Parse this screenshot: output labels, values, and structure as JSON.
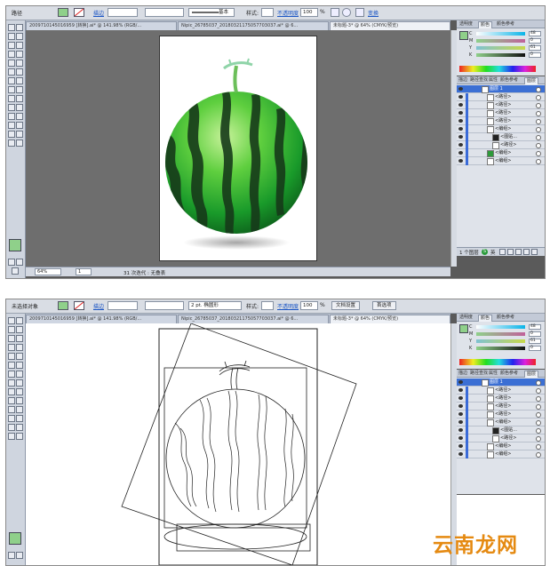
{
  "screenshot1": {
    "control_bar": {
      "selection_label": "路径",
      "stroke_label": "描边",
      "stroke_style": "基本",
      "style_label": "样式:",
      "opacity_label": "不透明度",
      "opacity_value": "100",
      "opacity_unit": "%",
      "transform_link": "变换"
    },
    "tabs": [
      {
        "label": "2009710145016959 [转换].ai* @ 141.98% (RGB/..."
      },
      {
        "label": "Nipic_26785037_20180321175057703037.ai* @ 6..."
      },
      {
        "label": "未标题-3* @ 64% (CMYK/预览)"
      }
    ],
    "status_bar": {
      "zoom": "64%",
      "page": "1",
      "status_text": "31 次迭代 : 无叠表"
    },
    "color_panel": {
      "tabs": [
        "透明度",
        "颜色",
        "颜色参考"
      ],
      "channels": [
        {
          "label": "C",
          "value": "48"
        },
        {
          "label": "M",
          "value": "0"
        },
        {
          "label": "Y",
          "value": "61"
        },
        {
          "label": "K",
          "value": "0"
        }
      ]
    },
    "layers_panel": {
      "tabs": [
        "描边",
        "路径查找",
        "属性",
        "颜色参考",
        "图层"
      ],
      "rows": [
        {
          "name": "图层 1"
        },
        {
          "name": "<路径>"
        },
        {
          "name": "<路径>"
        },
        {
          "name": "<路径>"
        },
        {
          "name": "<路径>"
        },
        {
          "name": "<编组>"
        },
        {
          "name": "<图贴..."
        },
        {
          "name": "<路径>"
        },
        {
          "name": "<编组>"
        },
        {
          "name": "<编组>"
        }
      ],
      "footer": "1 个图层"
    },
    "ime_label": "英"
  },
  "screenshot2": {
    "control_bar": {
      "selection_label": "未选择对象",
      "stroke_label": "描边",
      "stroke_weight": "2 pt. 椭圆形",
      "style_label": "样式:",
      "opacity_label": "不透明度",
      "opacity_value": "100",
      "opacity_unit": "%",
      "doc_setup_button": "文档设置",
      "preferences_button": "首选项"
    },
    "tabs": [
      {
        "label": "2009710145016959 [转换].ai* @ 141.98% (RGB/..."
      },
      {
        "label": "Nipic_26785037_20180321175057703037.ai* @ 6..."
      },
      {
        "label": "未标题-3* @ 64% (CMYK/预览)"
      }
    ],
    "color_panel": {
      "tabs": [
        "透明度",
        "颜色",
        "颜色参考"
      ],
      "channels": [
        {
          "label": "C",
          "value": "48"
        },
        {
          "label": "M",
          "value": "0"
        },
        {
          "label": "Y",
          "value": "61"
        },
        {
          "label": "K",
          "value": "0"
        }
      ]
    },
    "layers_panel": {
      "tabs": [
        "描边",
        "路径查找",
        "属性",
        "颜色参考",
        "图层"
      ],
      "rows": [
        {
          "name": "图层 1"
        },
        {
          "name": "<路径>"
        },
        {
          "name": "<路径>"
        },
        {
          "name": "<路径>"
        },
        {
          "name": "<路径>"
        },
        {
          "name": "<编组>"
        },
        {
          "name": "<图贴..."
        },
        {
          "name": "<路径>"
        },
        {
          "name": "<编组>"
        },
        {
          "name": "<编组>"
        }
      ]
    }
  },
  "watermark": "云南龙网",
  "colors": {
    "ui_panel": "#dfe3ea",
    "canvas_bg": "#6e6e6e",
    "selection_blue": "#3b6fd4",
    "fill_green": "#8fd08a",
    "watermark_orange": "#e58a12"
  }
}
